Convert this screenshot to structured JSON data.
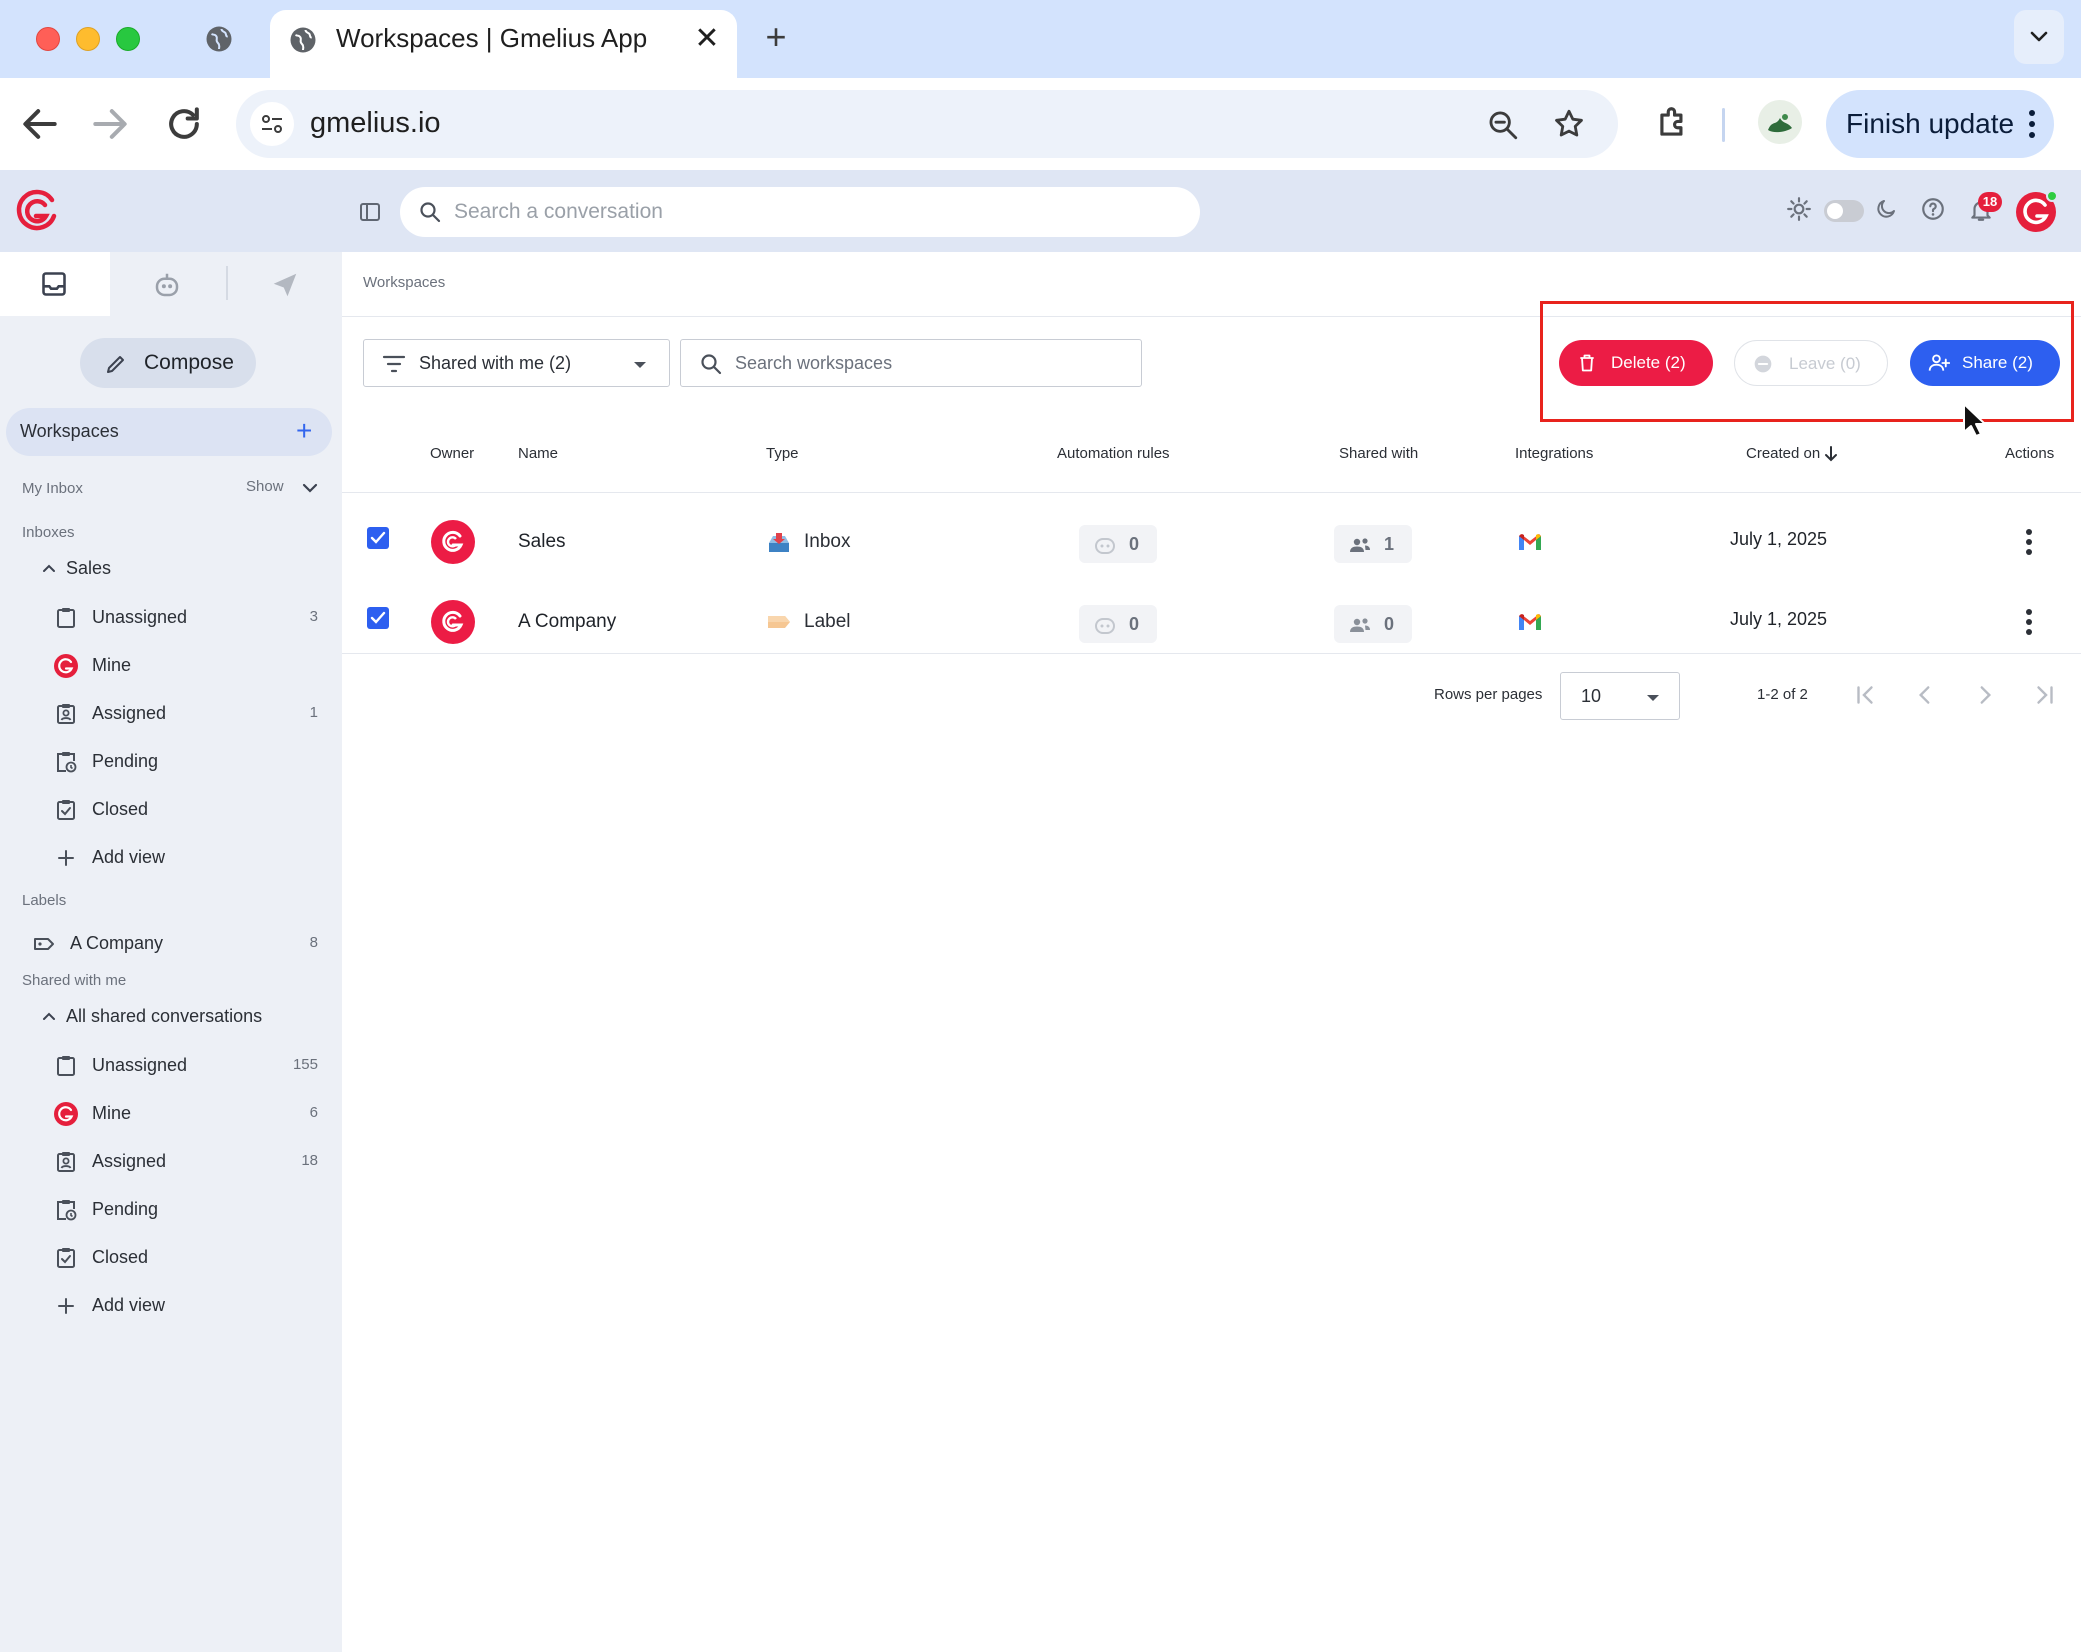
{
  "browser": {
    "tab_title": "Workspaces | Gmelius App",
    "url": "gmelius.io",
    "finish_update": "Finish update"
  },
  "header": {
    "search_placeholder": "Search a conversation",
    "notification_count": "18"
  },
  "sidebar": {
    "compose": "Compose",
    "workspaces": "Workspaces",
    "my_inbox": "My Inbox",
    "show": "Show",
    "inboxes_title": "Inboxes",
    "sales_group": "Sales",
    "sales_items": [
      {
        "label": "Unassigned",
        "count": "3"
      },
      {
        "label": "Mine",
        "count": ""
      },
      {
        "label": "Assigned",
        "count": "1"
      },
      {
        "label": "Pending",
        "count": ""
      },
      {
        "label": "Closed",
        "count": ""
      },
      {
        "label": "Add view",
        "count": ""
      }
    ],
    "labels_title": "Labels",
    "label_items": [
      {
        "label": "A Company",
        "count": "8"
      }
    ],
    "shared_title": "Shared with me",
    "shared_group": "All shared conversations",
    "shared_items": [
      {
        "label": "Unassigned",
        "count": "155"
      },
      {
        "label": "Mine",
        "count": "6"
      },
      {
        "label": "Assigned",
        "count": "18"
      },
      {
        "label": "Pending",
        "count": ""
      },
      {
        "label": "Closed",
        "count": ""
      },
      {
        "label": "Add view",
        "count": ""
      }
    ]
  },
  "main": {
    "breadcrumb": "Workspaces",
    "filter_label": "Shared with me (2)",
    "search_placeholder": "Search workspaces",
    "delete_label": "Delete (2)",
    "leave_label": "Leave (0)",
    "share_label": "Share (2)",
    "columns": {
      "owner": "Owner",
      "name": "Name",
      "type": "Type",
      "automation": "Automation rules",
      "shared": "Shared with",
      "integrations": "Integrations",
      "created": "Created on",
      "actions": "Actions"
    },
    "rows": [
      {
        "name": "Sales",
        "type": "Inbox",
        "automation": "0",
        "shared": "1",
        "created": "July 1, 2025",
        "checked": true
      },
      {
        "name": "A Company",
        "type": "Label",
        "automation": "0",
        "shared": "0",
        "created": "July 1, 2025",
        "checked": true
      }
    ],
    "pagination": {
      "rows_per_page_label": "Rows per pages",
      "rows_per_page": "10",
      "range": "1-2 of 2"
    }
  },
  "colors": {
    "accent": "#2d5ff0",
    "danger": "#ec1c45",
    "brand": "#e51f3c",
    "highlight": "#e8231d"
  }
}
